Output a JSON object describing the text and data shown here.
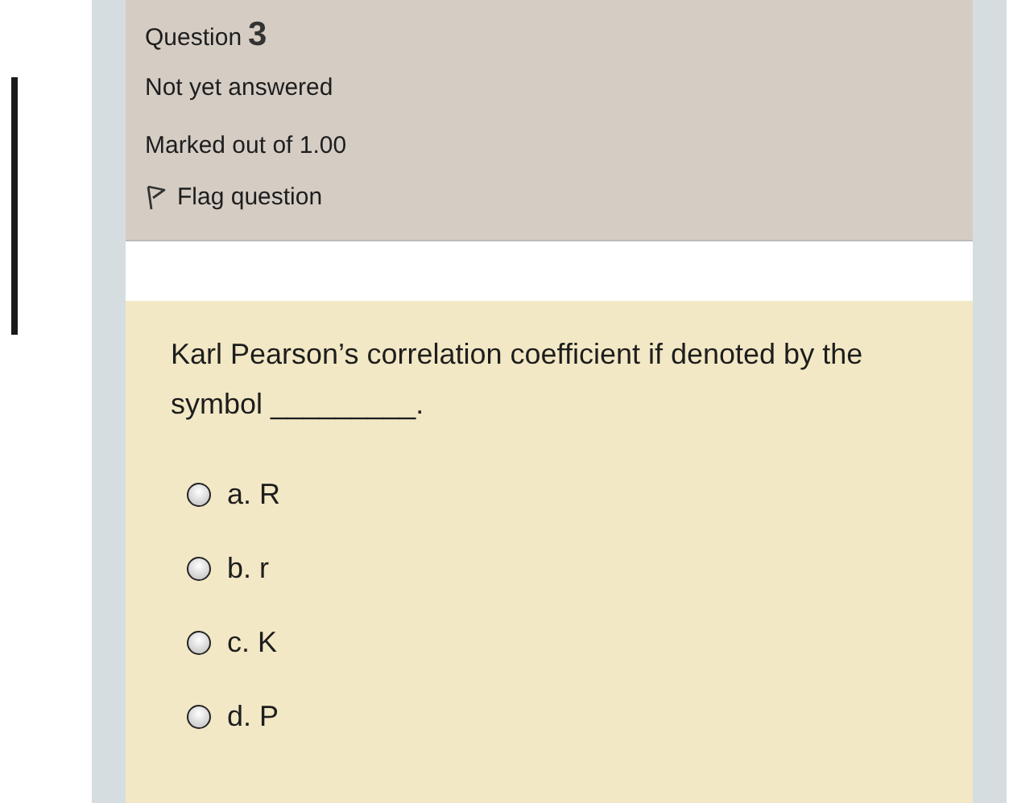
{
  "info": {
    "label": "Question",
    "number": "3",
    "state": "Not yet answered",
    "marks": "Marked out of 1.00",
    "flag": {
      "label": "Flag question",
      "flagged": false
    }
  },
  "question": {
    "text": "Karl Pearson’s correlation coefficient if denoted by the symbol _________.",
    "options": [
      {
        "label": "a. R",
        "selected": false
      },
      {
        "label": "b. r",
        "selected": false
      },
      {
        "label": "c. K",
        "selected": false
      },
      {
        "label": "d. P",
        "selected": false
      }
    ]
  }
}
